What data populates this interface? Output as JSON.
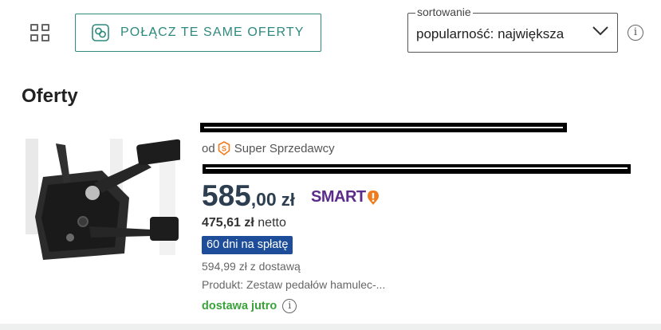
{
  "toolbar": {
    "grid_icon": "grid-view-icon",
    "merge_button_label": "POŁĄCZ TE SAME OFERTY",
    "merge_icon": "merge-offers-icon",
    "sort_label": "sortowanie",
    "sort_value": "popularność: największa",
    "info_icon": "i"
  },
  "section": {
    "title": "Oferty"
  },
  "offer": {
    "seller_prefix": "od",
    "seller_badge": "super-seller-badge-icon",
    "seller_label": "Super Sprzedawcy",
    "price_main": "585",
    "price_cents": ",00",
    "currency": "zł",
    "smart_label": "SMART",
    "netto_value": "475,61 zł",
    "netto_label": "netto",
    "installments": "60 dni na spłatę",
    "with_delivery": "594,99 zł z dostawą",
    "product": "Produkt: Zestaw pedałów hamulec-...",
    "delivery": "dostawa jutro",
    "delivery_info_icon": "i"
  },
  "colors": {
    "accent": "#2f8a7e",
    "price": "#2c3e50",
    "smart": "#5b2c8a",
    "smart_bang": "#f07c1d",
    "installments_bg": "#1e4e9a",
    "delivery": "#3aa23a"
  }
}
